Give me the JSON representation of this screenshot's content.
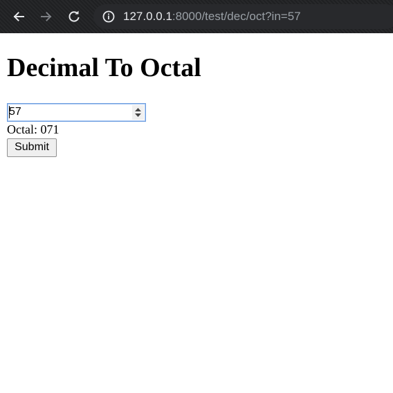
{
  "browser": {
    "url_host": "127.0.0.1",
    "url_rest": ":8000/test/dec/oct?in=57",
    "back_icon": "arrow-left-icon",
    "forward_icon": "arrow-right-icon",
    "reload_icon": "reload-icon",
    "info_icon": "info-icon"
  },
  "page": {
    "title": "Decimal To Octal",
    "input_value": "57",
    "result_text": "Octal: 071",
    "submit_label": "Submit"
  },
  "colors": {
    "toolbar_bg": "#1f2022",
    "address_bg": "#28292c",
    "input_focus_border": "#6f9fe0"
  }
}
